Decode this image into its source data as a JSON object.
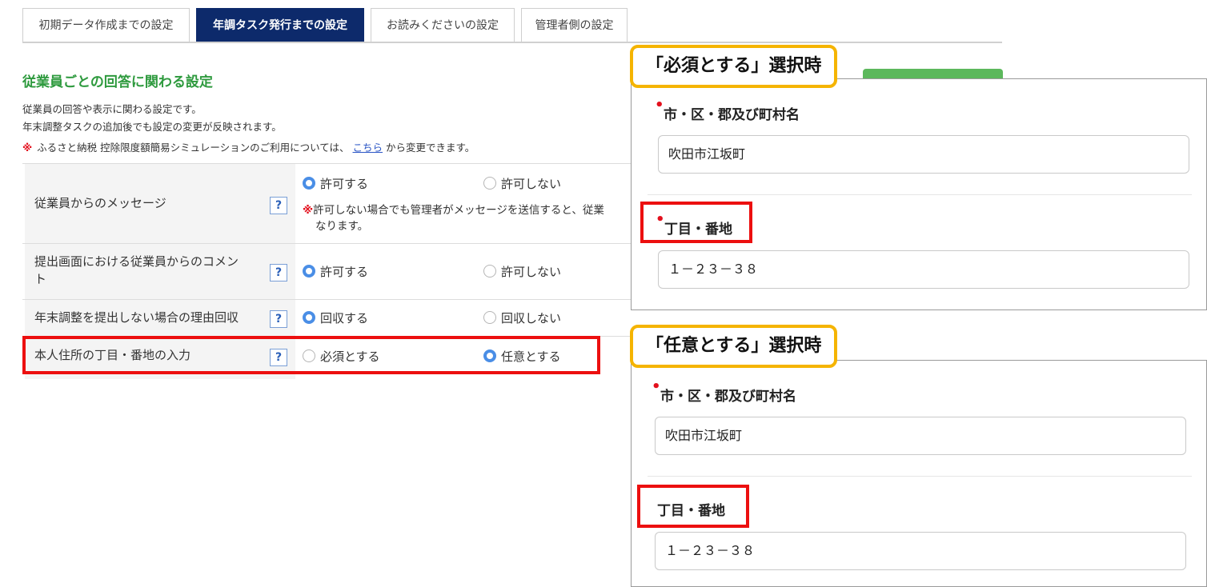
{
  "tabs": [
    {
      "label": "初期データ作成までの設定",
      "active": false
    },
    {
      "label": "年調タスク発行までの設定",
      "active": true
    },
    {
      "label": "お読みくださいの設定",
      "active": false
    },
    {
      "label": "管理者側の設定",
      "active": false
    }
  ],
  "section": {
    "title": "従業員ごとの回答に関わる設定",
    "desc_line1": "従業員の回答や表示に関わる設定です。",
    "desc_line2": "年末調整タスクの追加後でも設定の変更が反映されます。",
    "notice_mark": "※",
    "notice_before": "ふるさと納税 控除限度額簡易シミュレーションのご利用については、",
    "notice_link": "こちら",
    "notice_after": "から変更できます。"
  },
  "settings": {
    "help_label": "?",
    "rows": [
      {
        "label": "従業員からのメッセージ",
        "option_a": "許可する",
        "option_b": "許可しない",
        "selected": "a",
        "note_mark": "※",
        "note_line1": "許可しない場合でも管理者がメッセージを送信すると、従業",
        "note_line2": "なります。"
      },
      {
        "label_line1": "提出画面における従業員からのコメン",
        "label_line2": "ト",
        "option_a": "許可する",
        "option_b": "許可しない",
        "selected": "a"
      },
      {
        "label": "年末調整を提出しない場合の理由回収",
        "option_a": "回収する",
        "option_b": "回収しない",
        "selected": "a"
      },
      {
        "label": "本人住所の丁目・番地の入力",
        "option_a": "必須とする",
        "option_b": "任意とする",
        "selected": "b"
      }
    ]
  },
  "panel_required": {
    "callout": "「必須とする」選択時",
    "city_label": "市・区・郡及び町村名",
    "city_value": "吹田市江坂町",
    "block_label": "丁目・番地",
    "block_value": "１－２３－３８",
    "required_mark": "•"
  },
  "panel_optional": {
    "callout": "「任意とする」選択時",
    "city_label": "市・区・郡及び町村名",
    "city_value": "吹田市江坂町",
    "block_label": "丁目・番地",
    "block_value": "１－２３－３８",
    "required_mark": "•"
  },
  "colors": {
    "tab_active": "#0d2a6b",
    "section_title": "#2e9a3e",
    "highlight_red": "#ec0f0f",
    "callout_border": "#f5b400",
    "radio_checked": "#4a8ee6",
    "required_dot": "#e3101d"
  }
}
